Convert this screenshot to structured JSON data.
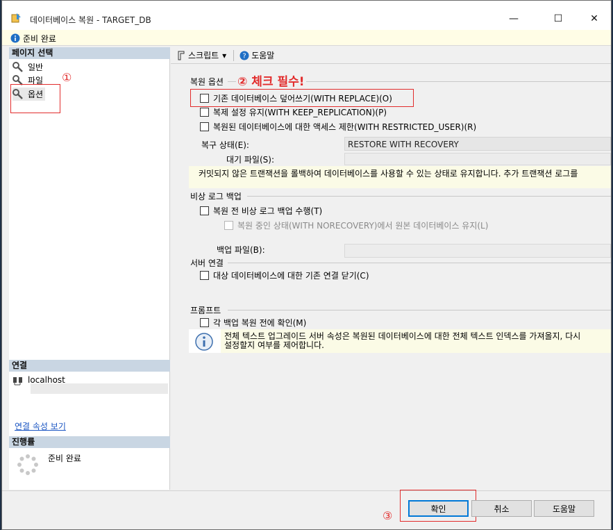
{
  "window": {
    "title": "데이터베이스 복원 - TARGET_DB",
    "minimize": "—",
    "maximize": "☐",
    "close": "✕"
  },
  "status_top": "준비 완료",
  "left": {
    "page_select_header": "페이지 선택",
    "pages": [
      "일반",
      "파일",
      "옵션"
    ],
    "connection_header": "연결",
    "server": "localhost",
    "view_connection_link": "연결 속성 보기",
    "progress_header": "진행률",
    "progress_status": "준비 완료"
  },
  "toolbar": {
    "script": "스크립트",
    "script_arrow": "▾",
    "help": "도움말"
  },
  "annotations": {
    "one": "①",
    "two": "② 체크 필수!",
    "three": "③"
  },
  "restore_options": {
    "group": "복원 옵션",
    "overwrite": "기존 데이터베이스 덮어쓰기(WITH REPLACE)(O)",
    "keep_replication": "복제 설정 유지(WITH KEEP_REPLICATION)(P)",
    "restricted_user": "복원된 데이터베이스에 대한 액세스 제한(WITH RESTRICTED_USER)(R)",
    "recovery_state_label": "복구 상태(E):",
    "recovery_state_value": "RESTORE WITH RECOVERY",
    "standby_file_label": "대기 파일(S):",
    "note": "커밋되지 않은 트랜잭션을 롤백하여 데이터베이스를 사용할 수 있는 상태로 유지합니다. 추가 트랜잭션 로그를"
  },
  "tail_log": {
    "group": "비상 로그 백업",
    "take_tail": "복원 전 비상 로그 백업 수행(T)",
    "norecovery": "복원 중인 상태(WITH NORECOVERY)에서 원본 데이터베이스 유지(L)",
    "backup_file_label": "백업 파일(B):"
  },
  "server_connections": {
    "group": "서버 연결",
    "close_existing": "대상 데이터베이스에 대한 기존 연결 닫기(C)"
  },
  "prompt": {
    "group": "프롬프트",
    "prompt_before": "각 백업 복원 전에 확인(M)",
    "info_text_1": "전체 텍스트 업그레이드 서버 속성은 복원된 데이터베이스에 대한 전체 텍스트 인덱스를 가져올지, 다시",
    "info_text_2": "설정할지 여부를 제어합니다."
  },
  "buttons": {
    "ok": "확인",
    "cancel": "취소",
    "help": "도움말"
  }
}
